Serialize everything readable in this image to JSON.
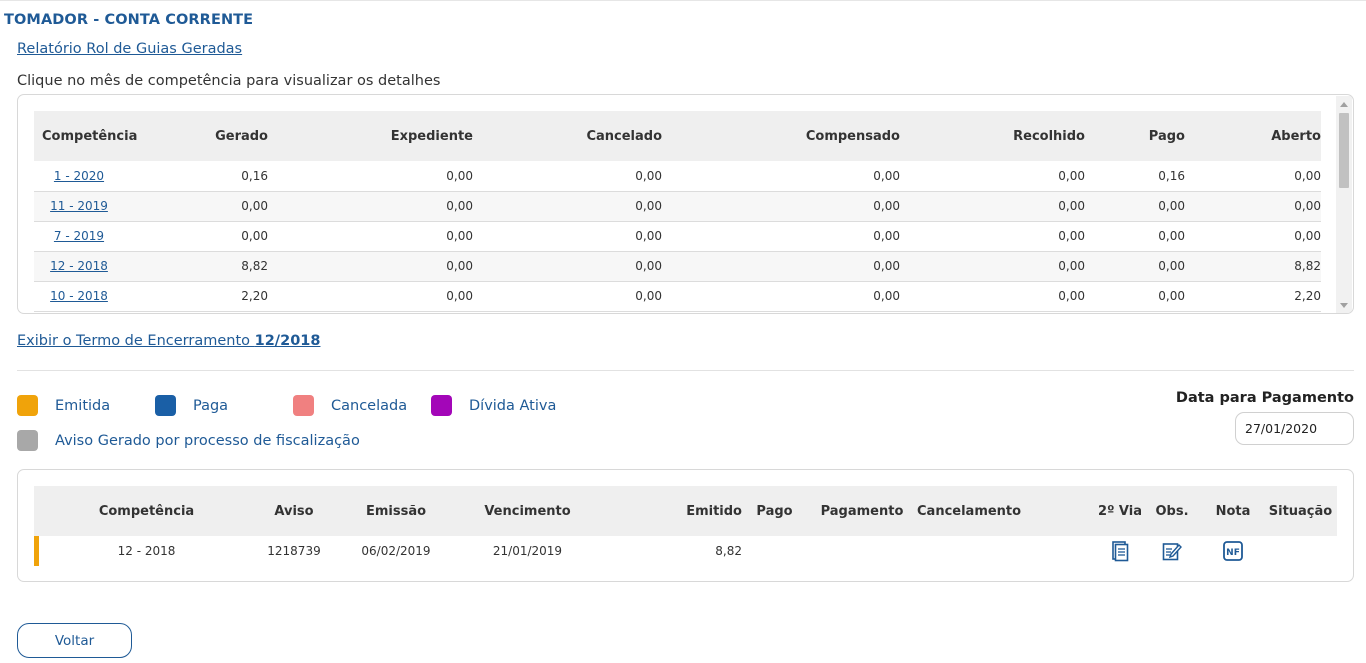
{
  "page": {
    "title": "TOMADOR - CONTA CORRENTE",
    "report_link": "Relatório Rol de Guias Geradas",
    "hint": "Clique no mês de competência para visualizar os detalhes"
  },
  "competence_table": {
    "headers": [
      "Competência",
      "Gerado",
      "Expediente",
      "Cancelado",
      "Compensado",
      "Recolhido",
      "Pago",
      "Aberto"
    ],
    "rows": [
      [
        "1 - 2020",
        "0,16",
        "0,00",
        "0,00",
        "0,00",
        "0,00",
        "0,16",
        "0,00"
      ],
      [
        "11 - 2019",
        "0,00",
        "0,00",
        "0,00",
        "0,00",
        "0,00",
        "0,00",
        "0,00"
      ],
      [
        "7 - 2019",
        "0,00",
        "0,00",
        "0,00",
        "0,00",
        "0,00",
        "0,00",
        "0,00"
      ],
      [
        "12 - 2018",
        "8,82",
        "0,00",
        "0,00",
        "0,00",
        "0,00",
        "0,00",
        "8,82"
      ],
      [
        "10 - 2018",
        "2,20",
        "0,00",
        "0,00",
        "0,00",
        "0,00",
        "0,00",
        "2,20"
      ]
    ]
  },
  "term": {
    "prefix": "Exibir o Termo de Encerramento ",
    "period": "12/2018"
  },
  "legend": [
    {
      "label": "Emitida",
      "color": "#f0a30a"
    },
    {
      "label": "Paga",
      "color": "#1a5fa6"
    },
    {
      "label": "Cancelada",
      "color": "#f08080"
    },
    {
      "label": "Dívida Ativa",
      "color": "#a306b8"
    },
    {
      "label": "Aviso Gerado por processo de fiscalização",
      "color": "#a8a8a8"
    }
  ],
  "payment": {
    "label": "Data para Pagamento",
    "date": "27/01/2020"
  },
  "guides_table": {
    "headers": [
      "Competência",
      "Aviso",
      "Emissão",
      "Vencimento",
      "Emitido",
      "Pago",
      "Pagamento",
      "Cancelamento",
      "2º Via",
      "Obs.",
      "Nota",
      "Situação"
    ],
    "rows": [
      {
        "status_color": "#f0a30a",
        "competencia": "12 - 2018",
        "aviso": "1218739",
        "emissao": "06/02/2019",
        "vencimento": "21/01/2019",
        "emitido": "8,82",
        "pago": "",
        "pagamento": "",
        "cancelamento": "",
        "icons": [
          "document-icon",
          "edit-note-icon",
          "nf-icon"
        ],
        "situacao": ""
      }
    ]
  },
  "actions": {
    "back": "Voltar"
  }
}
